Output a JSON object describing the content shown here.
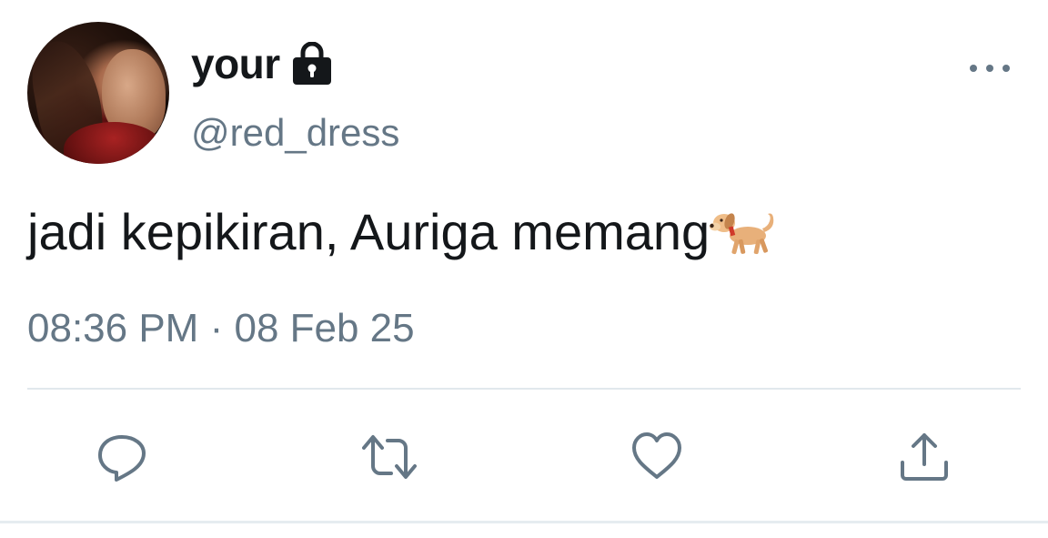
{
  "profile": {
    "display_name": "your",
    "handle": "@red_dress",
    "protected_icon": "lock-icon",
    "avatar": "profile-photo"
  },
  "tweet": {
    "text": "jadi kepikiran, Auriga memang",
    "emoji_icon": "dog-emoji-icon",
    "time": "08:36 PM",
    "separator": "·",
    "date": "08 Feb 25"
  },
  "actions": {
    "reply_icon": "reply-icon",
    "retweet_icon": "retweet-icon",
    "like_icon": "heart-icon",
    "share_icon": "share-icon",
    "more_icon": "more-icon"
  },
  "colors": {
    "text": "#14171a",
    "secondary": "#657786",
    "divider": "#e1e8ed"
  }
}
